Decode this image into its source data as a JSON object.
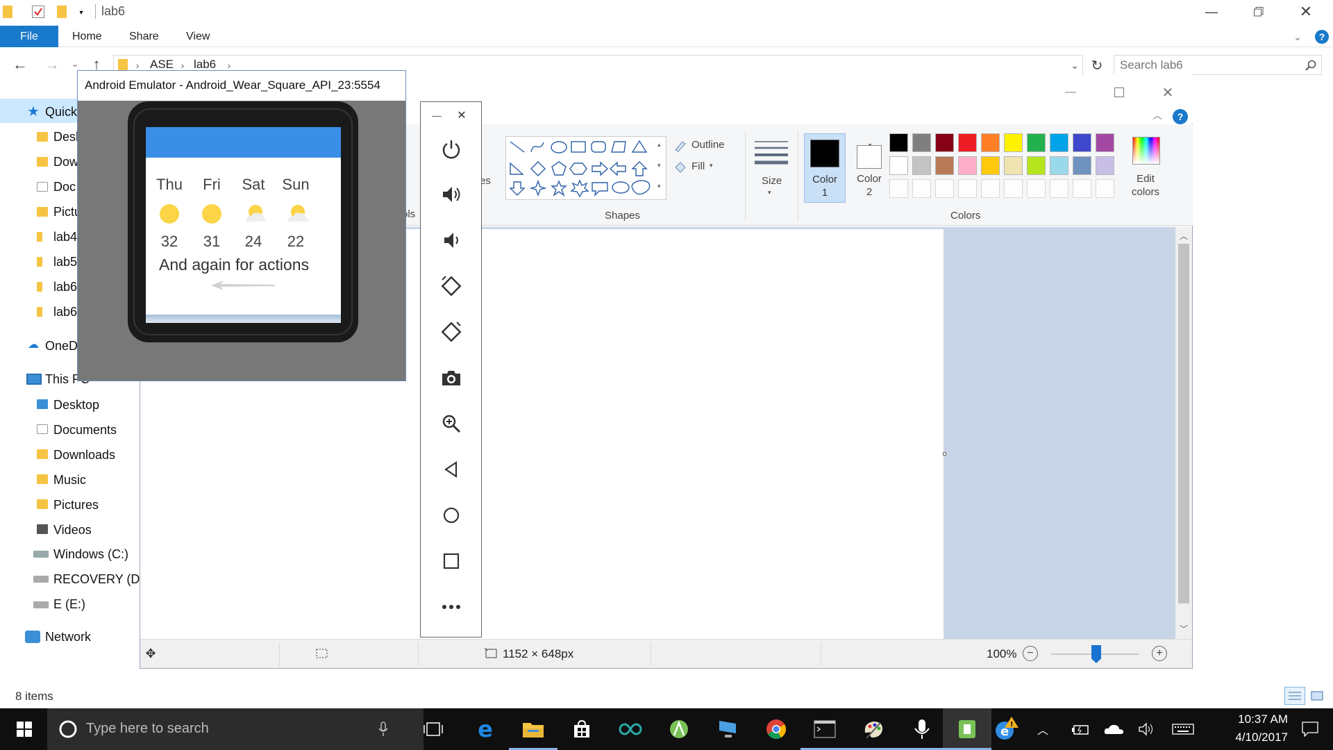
{
  "explorer": {
    "title": "lab6",
    "tabs": [
      "File",
      "Home",
      "Share",
      "View"
    ],
    "breadcrumb": [
      "ASE",
      "lab6"
    ],
    "search_placeholder": "Search lab6",
    "nav": {
      "quick_access": "Quick",
      "quick_items": [
        "Desk",
        "Dow",
        "Doc",
        "Pictu",
        "lab4",
        "lab5",
        "lab6",
        "lab6"
      ],
      "onedrive": "OneD",
      "this_pc": "This PC",
      "pc_items": [
        "Desktop",
        "Documents",
        "Downloads",
        "Music",
        "Pictures",
        "Videos",
        "Windows (C:)",
        "RECOVERY (D:)",
        "E (E:)"
      ],
      "network": "Network"
    },
    "status": "8 items"
  },
  "paint": {
    "ribbon": {
      "shapes_label": "Shapes",
      "outline_label": "Outline",
      "fill_label": "Fill",
      "size_label": "Size",
      "color1_label": "Color\n1",
      "color2_label": "Color\n2",
      "colors_label": "Colors",
      "edit_colors_label": "Edit\ncolors",
      "partial_es": "es",
      "partial_ols": "ols"
    },
    "palette_row1": [
      "#000000",
      "#7f7f7f",
      "#880015",
      "#ed1c24",
      "#ff7f27",
      "#fff200",
      "#22b14c",
      "#00a2e8",
      "#3f48cc",
      "#a349a4"
    ],
    "palette_row2": [
      "#ffffff",
      "#c3c3c3",
      "#b97a57",
      "#ffaec9",
      "#ffc90e",
      "#efe4b0",
      "#b5e61d",
      "#99d9ea",
      "#7092be",
      "#c8bfe7"
    ],
    "color1": "#000000",
    "color2": "#ffffff",
    "status": {
      "dimensions": "1152 × 648px",
      "zoom": "100%"
    }
  },
  "emulator": {
    "title": "Android Emulator - Android_Wear_Square_API_23:5554",
    "forecast": [
      {
        "day": "Thu",
        "temp": "32",
        "icon": "sun-icon"
      },
      {
        "day": "Fri",
        "temp": "31",
        "icon": "sun-icon"
      },
      {
        "day": "Sat",
        "temp": "24",
        "icon": "partly-cloudy-icon"
      },
      {
        "day": "Sun",
        "temp": "22",
        "icon": "partly-cloudy-icon"
      }
    ],
    "message": "And again for actions",
    "toolbar": [
      "power-icon",
      "volume-up-icon",
      "volume-down-icon",
      "rotate-left-icon",
      "rotate-right-icon",
      "camera-icon",
      "zoom-icon",
      "back-icon",
      "home-icon",
      "overview-icon",
      "more-icon"
    ]
  },
  "taskbar": {
    "search_placeholder": "Type here to search",
    "time": "10:37 AM",
    "date": "4/10/2017"
  }
}
